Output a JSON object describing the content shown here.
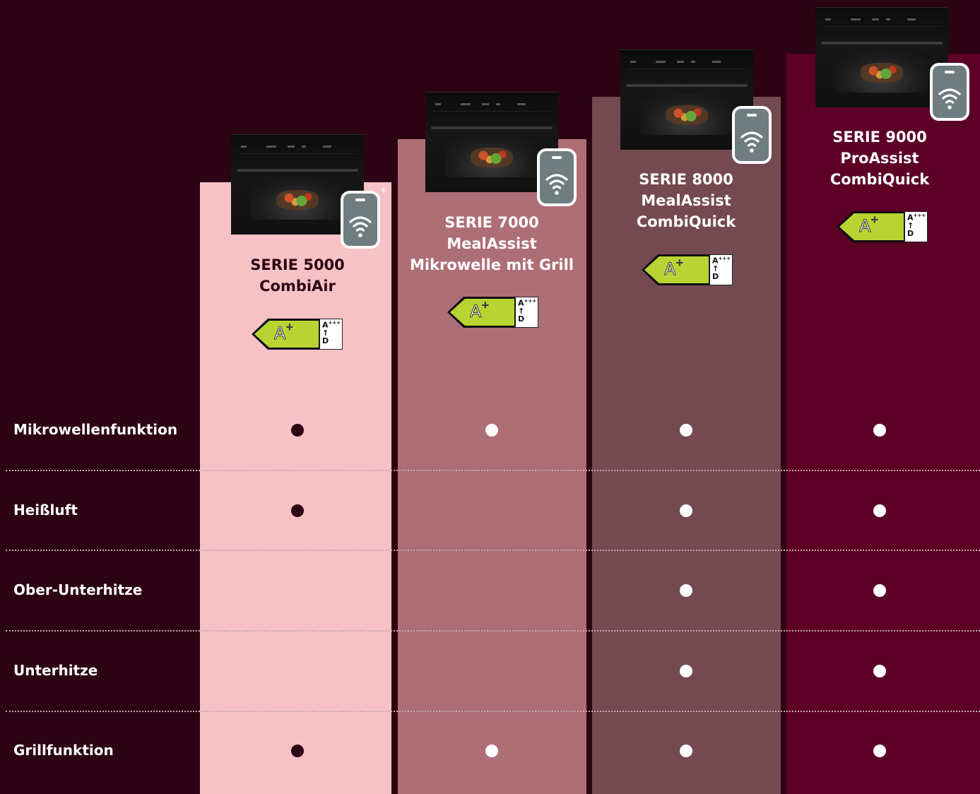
{
  "products": [
    {
      "id": "serie-5000",
      "title_lines": [
        "SERIE 5000",
        "CombiAir"
      ],
      "energy_class": "A",
      "energy_class_sup": "+",
      "energy_scale_top": "A",
      "energy_scale_top_sup": "+++",
      "energy_scale_arrow": "↑",
      "energy_scale_bottom": "D",
      "wifi_note": "*",
      "column_color": "#f7c2c6",
      "text_color": "#2c0414",
      "dot_color": "#2c0414",
      "wifi_icon": "smartphone-wifi-icon"
    },
    {
      "id": "serie-7000",
      "title_lines": [
        "SERIE 7000",
        "MealAssist",
        "Mikrowelle mit Grill"
      ],
      "energy_class": "A",
      "energy_class_sup": "+",
      "energy_scale_top": "A",
      "energy_scale_top_sup": "+++",
      "energy_scale_arrow": "↑",
      "energy_scale_bottom": "D",
      "column_color": "#ae6e76",
      "text_color": "#ffffff",
      "dot_color": "#ffffff",
      "wifi_icon": "smartphone-wifi-icon"
    },
    {
      "id": "serie-8000",
      "title_lines": [
        "SERIE 8000",
        "MealAssist",
        "CombiQuick"
      ],
      "energy_class": "A",
      "energy_class_sup": "+",
      "energy_scale_top": "A",
      "energy_scale_top_sup": "+++",
      "energy_scale_arrow": "↑",
      "energy_scale_bottom": "D",
      "column_color": "#754951",
      "text_color": "#ffffff",
      "dot_color": "#ffffff",
      "wifi_icon": "smartphone-wifi-icon"
    },
    {
      "id": "serie-9000",
      "title_lines": [
        "SERIE 9000",
        "ProAssist",
        "CombiQuick"
      ],
      "energy_class": "A",
      "energy_class_sup": "+",
      "energy_scale_top": "A",
      "energy_scale_top_sup": "+++",
      "energy_scale_arrow": "↑",
      "energy_scale_bottom": "D",
      "column_color": "#5c0026",
      "text_color": "#ffffff",
      "dot_color": "#ffffff",
      "wifi_icon": "smartphone-wifi-icon"
    }
  ],
  "features": [
    {
      "label": "Mikrowellenfunktion",
      "availability": [
        true,
        true,
        true,
        true
      ]
    },
    {
      "label": "Heißluft",
      "availability": [
        true,
        false,
        true,
        true
      ]
    },
    {
      "label": "Ober-Unterhitze",
      "availability": [
        false,
        false,
        true,
        true
      ]
    },
    {
      "label": "Unterhitze",
      "availability": [
        false,
        false,
        true,
        true
      ]
    },
    {
      "label": "Grillfunktion",
      "availability": [
        true,
        true,
        true,
        true
      ]
    }
  ],
  "colors": {
    "background": "#2c0414",
    "energy_green": "#b9d432",
    "divider": "#c7a6b1"
  }
}
